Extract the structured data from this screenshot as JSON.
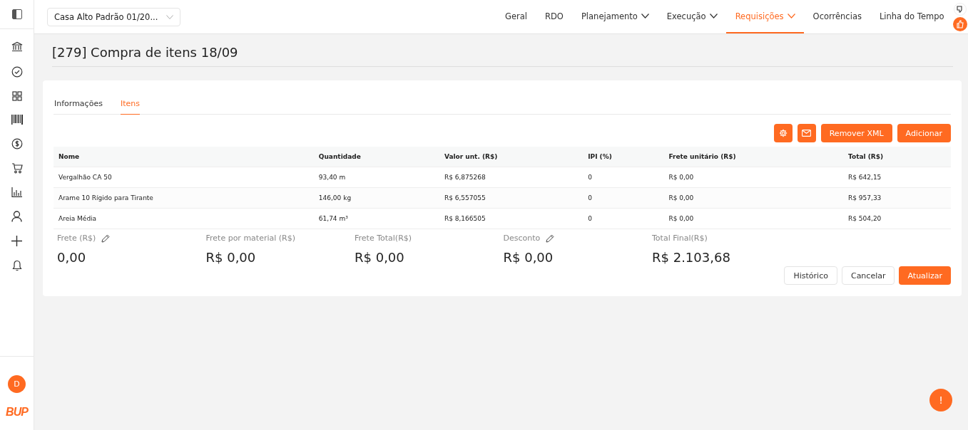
{
  "project_selector": {
    "value": "Casa Alto Padrão 01/20..."
  },
  "nav": [
    {
      "label": "Geral",
      "dropdown": false,
      "selected": false
    },
    {
      "label": "RDO",
      "dropdown": false,
      "selected": false
    },
    {
      "label": "Planejamento",
      "dropdown": true,
      "selected": false
    },
    {
      "label": "Execução",
      "dropdown": true,
      "selected": false
    },
    {
      "label": "Requisições",
      "dropdown": true,
      "selected": true
    },
    {
      "label": "Ocorrências",
      "dropdown": false,
      "selected": false
    },
    {
      "label": "Linha do Tempo",
      "dropdown": false,
      "selected": false
    }
  ],
  "sidebar": {
    "items": [
      {
        "kind": "bank"
      },
      {
        "kind": "check"
      },
      {
        "kind": "grid"
      },
      {
        "kind": "barcode"
      },
      {
        "kind": "dollar"
      },
      {
        "kind": "cart"
      },
      {
        "kind": "chart"
      },
      {
        "kind": "user"
      },
      {
        "kind": "plus"
      },
      {
        "kind": "bell"
      }
    ],
    "avatar": "D",
    "logo": "BUP"
  },
  "page_title": "[279] Compra de itens 18/09",
  "tabs": [
    {
      "label": "Informações",
      "selected": false
    },
    {
      "label": "Itens",
      "selected": true
    }
  ],
  "toolbar": {
    "icon_buttons": [
      {
        "kind": "settings"
      },
      {
        "kind": "mail"
      }
    ],
    "buttons": [
      "Remover XML",
      "Adicionar"
    ]
  },
  "table": {
    "columns": [
      "Nome",
      "Quantidade",
      "Valor unt. (R$)",
      "IPI (%)",
      "Frete unitário (R$)",
      "Total (R$)"
    ],
    "rows": [
      [
        "Vergalhão CA 50",
        "93,40 m",
        "R$ 6,875268",
        "0",
        "R$ 0,00",
        "R$ 642,15"
      ],
      [
        "Arame 10 Rígido para Tirante",
        "146,00 kg",
        "R$ 6,557055",
        "0",
        "R$ 0,00",
        "R$ 957,33"
      ],
      [
        "Areia Média",
        "61,74 m³",
        "R$ 8,166505",
        "0",
        "R$ 0,00",
        "R$ 504,20"
      ]
    ]
  },
  "summary": [
    {
      "label": "Frete (R$)",
      "value": "0,00",
      "editable": true
    },
    {
      "label": "Frete por material (R$)",
      "value": "R$ 0,00",
      "editable": false
    },
    {
      "label": "Frete Total(R$)",
      "value": "R$ 0,00",
      "editable": false
    },
    {
      "label": "Desconto",
      "value": "R$ 0,00",
      "editable": true
    },
    {
      "label": "Total Final(R$)",
      "value": "R$ 2.103,68",
      "editable": false
    }
  ],
  "actions": [
    {
      "label": "Histórico",
      "kind": "secondary"
    },
    {
      "label": "Cancelar",
      "kind": "secondary"
    },
    {
      "label": "Atualizar",
      "kind": "primary"
    }
  ],
  "help_button": "!"
}
